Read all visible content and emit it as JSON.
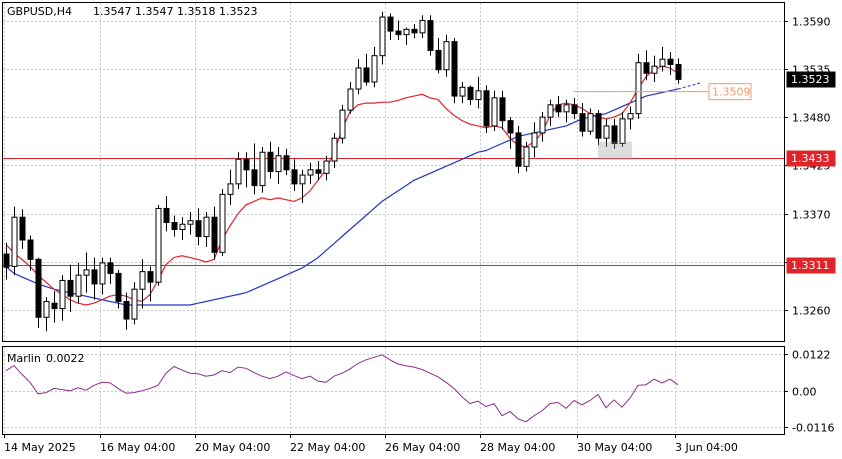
{
  "header": {
    "symbol": "GBPUSD,H4",
    "open": "1.3547",
    "high": "1.3547",
    "low": "1.3518",
    "close": "1.3523"
  },
  "indicator": {
    "name": "Marlin",
    "value": "0.0022"
  },
  "colors": {
    "background": "#ffffff",
    "plot_bg": "#e9e9e9",
    "ma_fast": "#e0242a",
    "ma_slow": "#1f35c8",
    "hline": "#e0242a",
    "oscillator": "#8a2f8f",
    "price_box": "#000000",
    "level_box_outline": "#f19a6e"
  },
  "chart_data": [
    {
      "type": "candlestick",
      "title": "GBPUSD,H4",
      "x_tick_labels": [
        "14 May 2025",
        "16 May 04:00",
        "20 May 04:00",
        "22 May 04:00",
        "26 May 04:00",
        "28 May 04:00",
        "30 May 04:00",
        "3 Jun 04:00"
      ],
      "y_tick_labels": [
        "1.3590",
        "1.3535",
        "1.3480",
        "1.3425",
        "1.3370",
        "1.3315",
        "1.3260"
      ],
      "ylim": [
        1.3225,
        1.361
      ],
      "current_price": "1.3523",
      "horizontal_levels": [
        "1.3433",
        "1.3311"
      ],
      "annotated_level": "1.3509",
      "grid": true,
      "candles": [
        [
          1.3324,
          1.3337,
          1.3295,
          1.3309
        ],
        [
          1.331,
          1.3378,
          1.33,
          1.3366
        ],
        [
          1.3366,
          1.3375,
          1.333,
          1.334
        ],
        [
          1.334,
          1.3345,
          1.3305,
          1.3318
        ],
        [
          1.3318,
          1.332,
          1.324,
          1.3252
        ],
        [
          1.3252,
          1.3275,
          1.3236,
          1.327
        ],
        [
          1.3268,
          1.3282,
          1.3246,
          1.3262
        ],
        [
          1.3262,
          1.33,
          1.3248,
          1.3294
        ],
        [
          1.3294,
          1.3312,
          1.3258,
          1.3276
        ],
        [
          1.3276,
          1.3314,
          1.3268,
          1.33
        ],
        [
          1.33,
          1.3326,
          1.328,
          1.3306
        ],
        [
          1.3306,
          1.332,
          1.3272,
          1.329
        ],
        [
          1.329,
          1.332,
          1.3278,
          1.3314
        ],
        [
          1.3314,
          1.332,
          1.329,
          1.3302
        ],
        [
          1.3302,
          1.3306,
          1.3262,
          1.327
        ],
        [
          1.327,
          1.328,
          1.3238,
          1.325
        ],
        [
          1.325,
          1.3292,
          1.3244,
          1.3284
        ],
        [
          1.3284,
          1.3318,
          1.3262,
          1.3304
        ],
        [
          1.3304,
          1.331,
          1.327,
          1.3292
        ],
        [
          1.3292,
          1.338,
          1.3288,
          1.3376
        ],
        [
          1.3376,
          1.339,
          1.335,
          1.336
        ],
        [
          1.336,
          1.3368,
          1.3344,
          1.3352
        ],
        [
          1.3352,
          1.3366,
          1.334,
          1.3358
        ],
        [
          1.3358,
          1.3372,
          1.3346,
          1.3362
        ],
        [
          1.3362,
          1.3376,
          1.3334,
          1.3344
        ],
        [
          1.3344,
          1.3372,
          1.3332,
          1.3366
        ],
        [
          1.3366,
          1.3378,
          1.3318,
          1.3326
        ],
        [
          1.3326,
          1.3398,
          1.3322,
          1.3392
        ],
        [
          1.3392,
          1.342,
          1.338,
          1.3404
        ],
        [
          1.3404,
          1.344,
          1.3398,
          1.3432
        ],
        [
          1.3432,
          1.344,
          1.34,
          1.342
        ],
        [
          1.342,
          1.345,
          1.3392,
          1.3402
        ],
        [
          1.3402,
          1.3446,
          1.3394,
          1.344
        ],
        [
          1.344,
          1.3452,
          1.341,
          1.3418
        ],
        [
          1.3418,
          1.3446,
          1.3404,
          1.3436
        ],
        [
          1.3436,
          1.3444,
          1.3414,
          1.342
        ],
        [
          1.342,
          1.3432,
          1.3396,
          1.3404
        ],
        [
          1.3404,
          1.342,
          1.3382,
          1.3414
        ],
        [
          1.3414,
          1.3428,
          1.3404,
          1.342
        ],
        [
          1.342,
          1.343,
          1.3408,
          1.3416
        ],
        [
          1.3416,
          1.3436,
          1.3408,
          1.343
        ],
        [
          1.343,
          1.3462,
          1.3422,
          1.3456
        ],
        [
          1.3456,
          1.3494,
          1.345,
          1.3488
        ],
        [
          1.3488,
          1.352,
          1.3484,
          1.3512
        ],
        [
          1.3512,
          1.3546,
          1.3506,
          1.3536
        ],
        [
          1.3536,
          1.3552,
          1.3516,
          1.352
        ],
        [
          1.352,
          1.356,
          1.3514,
          1.355
        ],
        [
          1.355,
          1.36,
          1.354,
          1.3594
        ],
        [
          1.3594,
          1.3598,
          1.3568,
          1.3578
        ],
        [
          1.3578,
          1.359,
          1.3568,
          1.3574
        ],
        [
          1.3574,
          1.3582,
          1.3562,
          1.358
        ],
        [
          1.358,
          1.3586,
          1.357,
          1.3576
        ],
        [
          1.3576,
          1.3596,
          1.357,
          1.359
        ],
        [
          1.359,
          1.3596,
          1.355,
          1.3556
        ],
        [
          1.3556,
          1.357,
          1.353,
          1.3534
        ],
        [
          1.3534,
          1.3574,
          1.3526,
          1.3566
        ],
        [
          1.3566,
          1.357,
          1.3496,
          1.3504
        ],
        [
          1.3504,
          1.352,
          1.3496,
          1.3514
        ],
        [
          1.3514,
          1.3516,
          1.3494,
          1.35
        ],
        [
          1.35,
          1.3526,
          1.349,
          1.351
        ],
        [
          1.351,
          1.3516,
          1.3462,
          1.347
        ],
        [
          1.347,
          1.351,
          1.3464,
          1.3502
        ],
        [
          1.3502,
          1.351,
          1.3466,
          1.3476
        ],
        [
          1.3476,
          1.348,
          1.3444,
          1.3462
        ],
        [
          1.3462,
          1.347,
          1.3416,
          1.3424
        ],
        [
          1.3424,
          1.3452,
          1.3418,
          1.3446
        ],
        [
          1.3446,
          1.3474,
          1.3434,
          1.3462
        ],
        [
          1.3462,
          1.3486,
          1.3452,
          1.348
        ],
        [
          1.348,
          1.35,
          1.347,
          1.3494
        ],
        [
          1.3494,
          1.3504,
          1.348,
          1.3486
        ],
        [
          1.3486,
          1.35,
          1.3474,
          1.3494
        ],
        [
          1.3494,
          1.3502,
          1.3478,
          1.3484
        ],
        [
          1.3484,
          1.3496,
          1.3458,
          1.3464
        ],
        [
          1.3464,
          1.349,
          1.346,
          1.3484
        ],
        [
          1.3484,
          1.3488,
          1.3448,
          1.3456
        ],
        [
          1.3456,
          1.3478,
          1.3446,
          1.347
        ],
        [
          1.347,
          1.3478,
          1.3444,
          1.345
        ],
        [
          1.345,
          1.3486,
          1.3446,
          1.3478
        ],
        [
          1.3478,
          1.3492,
          1.3466,
          1.3484
        ],
        [
          1.3484,
          1.3552,
          1.3478,
          1.3542
        ],
        [
          1.3542,
          1.3556,
          1.3522,
          1.353
        ],
        [
          1.353,
          1.355,
          1.352,
          1.3538
        ],
        [
          1.3538,
          1.356,
          1.3532,
          1.3546
        ],
        [
          1.3546,
          1.3554,
          1.3528,
          1.354
        ],
        [
          1.354,
          1.3547,
          1.3518,
          1.3523
        ]
      ],
      "ma_fast": [
        1.3335,
        1.3325,
        1.3318,
        1.331,
        1.33,
        1.3292,
        1.3284,
        1.3278,
        1.3272,
        1.3268,
        1.3266,
        1.3268,
        1.3272,
        1.3276,
        1.3278,
        1.3276,
        1.3272,
        1.327,
        1.3278,
        1.3294,
        1.3312,
        1.332,
        1.3322,
        1.332,
        1.3318,
        1.3315,
        1.3318,
        1.334,
        1.3356,
        1.337,
        1.338,
        1.3384,
        1.3388,
        1.3386,
        1.3388,
        1.3386,
        1.3384,
        1.3388,
        1.3396,
        1.3408,
        1.342,
        1.344,
        1.3466,
        1.3486,
        1.3494,
        1.3496,
        1.3496,
        1.3497,
        1.3497,
        1.3499,
        1.3502,
        1.3504,
        1.3506,
        1.3502,
        1.35,
        1.349,
        1.3482,
        1.3476,
        1.3472,
        1.347,
        1.3468,
        1.347,
        1.3468,
        1.3456,
        1.3448,
        1.3446,
        1.3452,
        1.3462,
        1.3482,
        1.3494,
        1.3496,
        1.3494,
        1.349,
        1.3484,
        1.348,
        1.3478,
        1.348,
        1.3484,
        1.3496,
        1.3512,
        1.3526,
        1.3534,
        1.3538,
        1.3536,
        1.353
      ],
      "ma_slow": [
        1.331,
        1.3302,
        1.3298,
        1.3294,
        1.329,
        1.3287,
        1.3284,
        1.3282,
        1.328,
        1.3278,
        1.3276,
        1.3274,
        1.3272,
        1.327,
        1.3268,
        1.3266,
        1.3266,
        1.3266,
        1.3266,
        1.3266,
        1.3266,
        1.3266,
        1.3266,
        1.3266,
        1.3268,
        1.327,
        1.3272,
        1.3274,
        1.3276,
        1.3278,
        1.328,
        1.3284,
        1.3288,
        1.3292,
        1.3296,
        1.33,
        1.3304,
        1.3308,
        1.3314,
        1.332,
        1.3328,
        1.3336,
        1.3344,
        1.3352,
        1.336,
        1.3368,
        1.3376,
        1.3384,
        1.339,
        1.3396,
        1.3402,
        1.3408,
        1.3412,
        1.3416,
        1.342,
        1.3424,
        1.3428,
        1.3432,
        1.3436,
        1.344,
        1.3442,
        1.3446,
        1.345,
        1.3454,
        1.3458,
        1.346,
        1.3462,
        1.3464,
        1.3466,
        1.3468,
        1.347,
        1.3474,
        1.3478,
        1.348,
        1.3482,
        1.3484,
        1.3488,
        1.3492,
        1.3496,
        1.35,
        1.3504,
        1.3506,
        1.3508,
        1.351,
        1.3512
      ]
    },
    {
      "type": "line",
      "title": "Marlin 0.0022",
      "y_tick_labels": [
        "0.0122",
        "0.00",
        "-0.0116"
      ],
      "ylim": [
        -0.014,
        0.0146
      ],
      "values": [
        0.0068,
        0.0085,
        0.0056,
        0.003,
        -0.0008,
        -0.0004,
        0.001,
        0.0006,
        0.0002,
        0.0012,
        0.0004,
        0.002,
        0.003,
        0.0028,
        0.001,
        -0.0006,
        -0.0004,
        0.0002,
        0.001,
        0.002,
        0.006,
        0.0082,
        0.007,
        0.006,
        0.0058,
        0.005,
        0.0054,
        0.0068,
        0.0062,
        0.008,
        0.0076,
        0.0062,
        0.005,
        0.0042,
        0.005,
        0.0064,
        0.0052,
        0.0042,
        0.005,
        0.0034,
        0.003,
        0.005,
        0.006,
        0.0074,
        0.0092,
        0.0104,
        0.0112,
        0.012,
        0.0104,
        0.009,
        0.0084,
        0.008,
        0.0072,
        0.006,
        0.0048,
        0.003,
        0.001,
        -0.0018,
        -0.004,
        -0.0032,
        -0.005,
        -0.004,
        -0.008,
        -0.0066,
        -0.009,
        -0.01,
        -0.008,
        -0.0064,
        -0.004,
        -0.0036,
        -0.0056,
        -0.003,
        -0.0044,
        -0.003,
        -0.001,
        -0.0054,
        -0.0028,
        -0.0052,
        -0.0022,
        0.002,
        0.0022,
        0.004,
        0.0028,
        0.004,
        0.0022
      ]
    }
  ]
}
